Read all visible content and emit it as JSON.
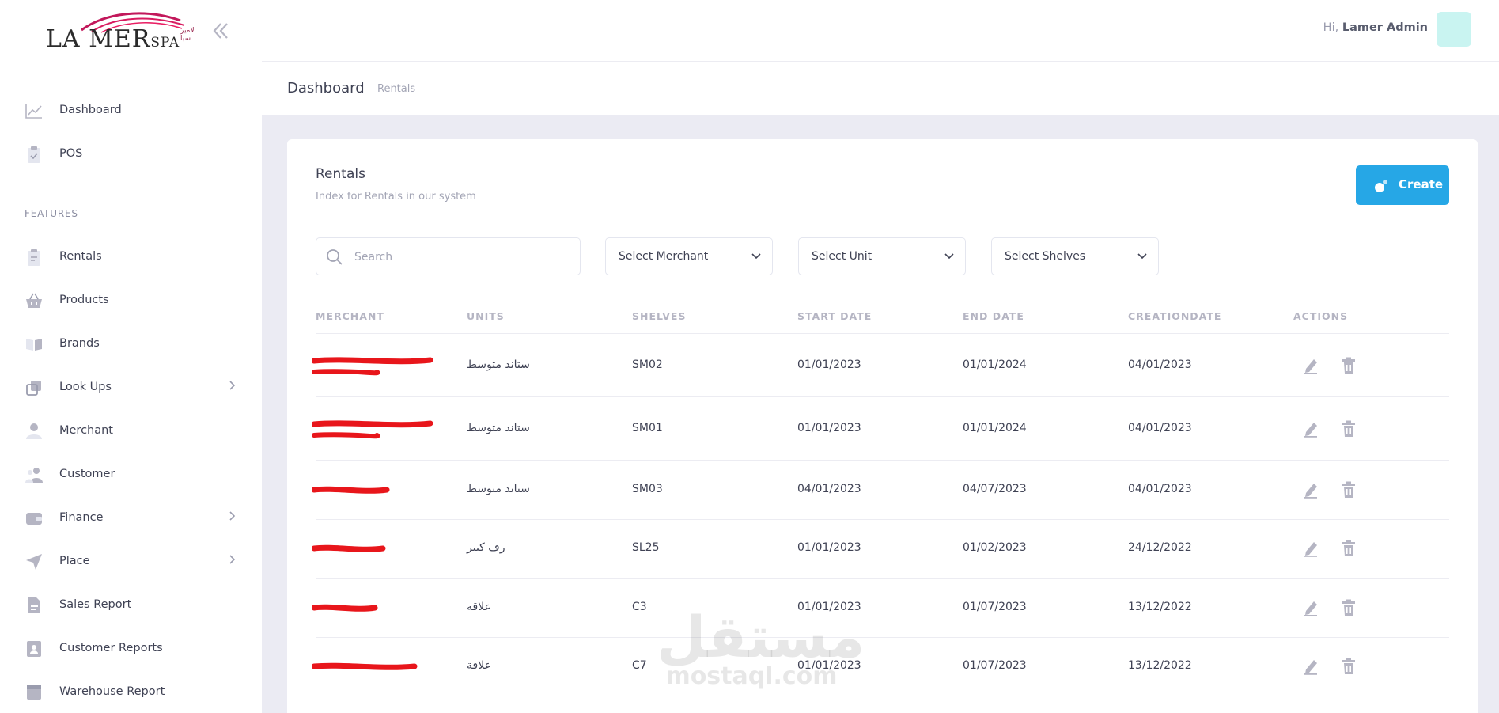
{
  "brand": {
    "name": "LA MER",
    "suffix": "SPA",
    "arabic": "لامير سبا"
  },
  "user": {
    "greeting": "Hi,",
    "name": "Lamer Admin"
  },
  "sidebar": {
    "top_items": [
      {
        "label": "Dashboard",
        "icon": "chart-line-icon"
      },
      {
        "label": "POS",
        "icon": "clipboard-check-icon"
      }
    ],
    "section_title": "FEATURES",
    "items": [
      {
        "label": "Rentals",
        "icon": "clipboard-icon",
        "has_children": false
      },
      {
        "label": "Products",
        "icon": "basket-icon",
        "has_children": false
      },
      {
        "label": "Brands",
        "icon": "book-icon",
        "has_children": false
      },
      {
        "label": "Look Ups",
        "icon": "layers-icon",
        "has_children": true
      },
      {
        "label": "Merchant",
        "icon": "user-icon",
        "has_children": false
      },
      {
        "label": "Customer",
        "icon": "users-icon",
        "has_children": false
      },
      {
        "label": "Finance",
        "icon": "wallet-icon",
        "has_children": true
      },
      {
        "label": "Place",
        "icon": "navigation-icon",
        "has_children": true
      },
      {
        "label": "Sales Report",
        "icon": "document-icon",
        "has_children": false
      },
      {
        "label": "Customer Reports",
        "icon": "contact-card-icon",
        "has_children": false
      },
      {
        "label": "Warehouse Report",
        "icon": "box-icon",
        "has_children": false
      }
    ]
  },
  "subheader": {
    "title": "Dashboard",
    "crumb": "Rentals"
  },
  "card": {
    "title": "Rentals",
    "subtitle": "Index for Rentals in our system",
    "create_label": "Create"
  },
  "filters": {
    "search_placeholder": "Search",
    "merchant": "Select Merchant",
    "unit": "Select Unit",
    "shelves": "Select Shelves"
  },
  "table": {
    "headers": [
      "MERCHANT",
      "UNITS",
      "SHELVES",
      "START DATE",
      "END DATE",
      "CREATIONDATE",
      "ACTIONS"
    ],
    "rows": [
      {
        "unit": "ستاند متوسط",
        "shelf": "SM02",
        "start": "01/01/2023",
        "end": "01/01/2024",
        "created": "04/01/2023"
      },
      {
        "unit": "ستاند متوسط",
        "shelf": "SM01",
        "start": "01/01/2023",
        "end": "01/01/2024",
        "created": "04/01/2023"
      },
      {
        "unit": "ستاند متوسط",
        "shelf": "SM03",
        "start": "04/01/2023",
        "end": "04/07/2023",
        "created": "04/01/2023"
      },
      {
        "unit": "رف كبير",
        "shelf": "SL25",
        "start": "01/01/2023",
        "end": "01/02/2023",
        "created": "24/12/2022"
      },
      {
        "unit": "علاقة",
        "shelf": "C3",
        "start": "01/01/2023",
        "end": "01/07/2023",
        "created": "13/12/2022"
      },
      {
        "unit": "علاقة",
        "shelf": "C7",
        "start": "01/01/2023",
        "end": "01/07/2023",
        "created": "13/12/2022"
      }
    ]
  },
  "watermark": {
    "arabic": "مستقل",
    "latin": "mostaql.com"
  },
  "colors": {
    "accent": "#26a7e6",
    "avatar": "#c9f4f1",
    "redaction": "#e8161b",
    "logo_swoosh": "#c2185b"
  }
}
